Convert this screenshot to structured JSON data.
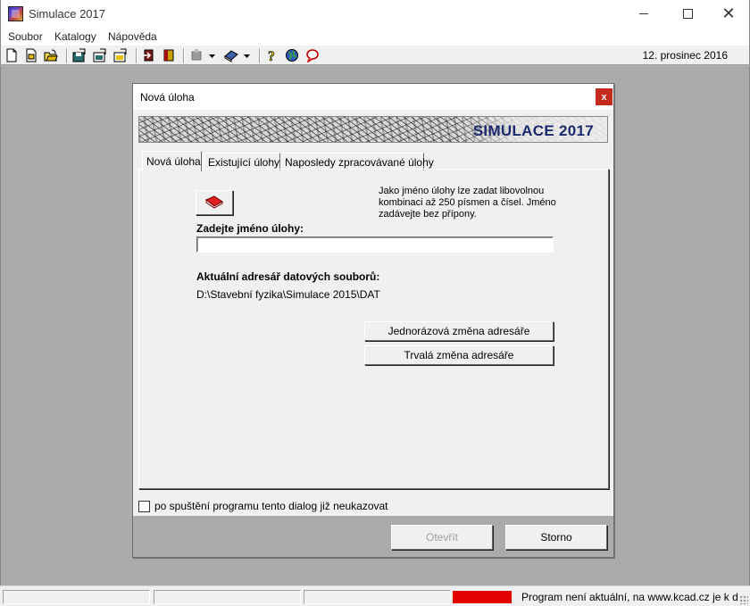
{
  "window": {
    "title": "Simulace 2017",
    "minimize_symbol": "",
    "close_symbol": "✕"
  },
  "menu": {
    "items": [
      "Soubor",
      "Katalogy",
      "Nápověda"
    ]
  },
  "toolbar": {
    "date": "12. prosinec 2016",
    "icons": [
      "new-file-icon",
      "open-file-icon",
      "open-folder-icon",
      "save-icon",
      "save-as-icon",
      "save-all-icon",
      "exit-icon",
      "book-red-icon",
      "tool-dropdown-icon",
      "catalog-dropdown-icon",
      "help-icon",
      "web-icon",
      "chat-icon"
    ]
  },
  "dialog": {
    "title": "Nová úloha",
    "close_symbol": "x",
    "banner_text": "SIMULACE 2017",
    "tabs": [
      "Nová úloha",
      "Existující úlohy",
      "Naposledy zpracovávané úlohy"
    ],
    "info_text": "Jako jméno úlohy lze zadat libovolnou kombinaci až 250 písmen a čísel. Jméno zadávejte bez přípony.",
    "name_label": "Zadejte jméno úlohy:",
    "name_value": "",
    "dir_label": "Aktuální adresář datových souborů:",
    "dir_path": "D:\\Stavební fyzika\\Simulace 2015\\DAT",
    "btn_once": "Jednorázová změna adresáře",
    "btn_permanent": "Trvalá změna adresáře",
    "checkbox_label": "po spuštění programu tento dialog již neukazovat",
    "btn_open": "Otevřít",
    "btn_cancel": "Storno"
  },
  "status": {
    "message": "Program není aktuální, na www.kcad.cz je k dispc",
    "alert_color": "#e30000"
  }
}
